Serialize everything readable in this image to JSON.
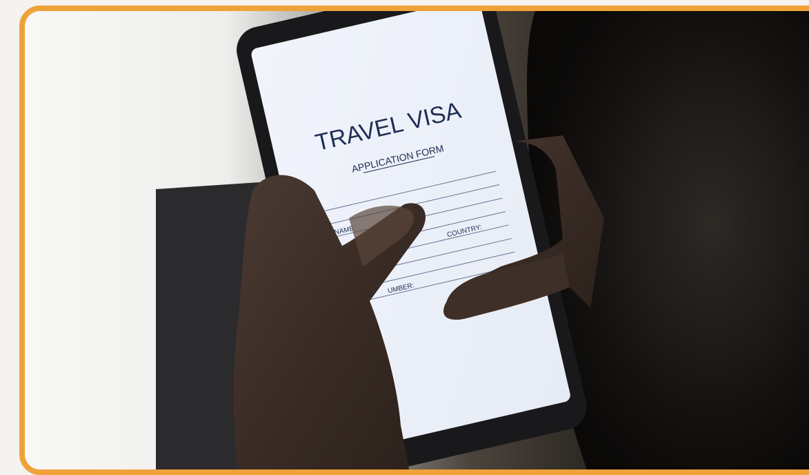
{
  "photo": {
    "subject": "hands holding a smartphone showing a travel visa application form",
    "screen": {
      "title": "TRAVEL VISA",
      "subtitle": "APPLICATION FORM",
      "fields": [
        "FIRST NAME",
        "COUNTRY:",
        "UMBER:"
      ]
    }
  },
  "colors": {
    "frame_border": "#f0a23a",
    "screen_text": "#1f2d55",
    "phone_body": "#1a1a1c"
  }
}
